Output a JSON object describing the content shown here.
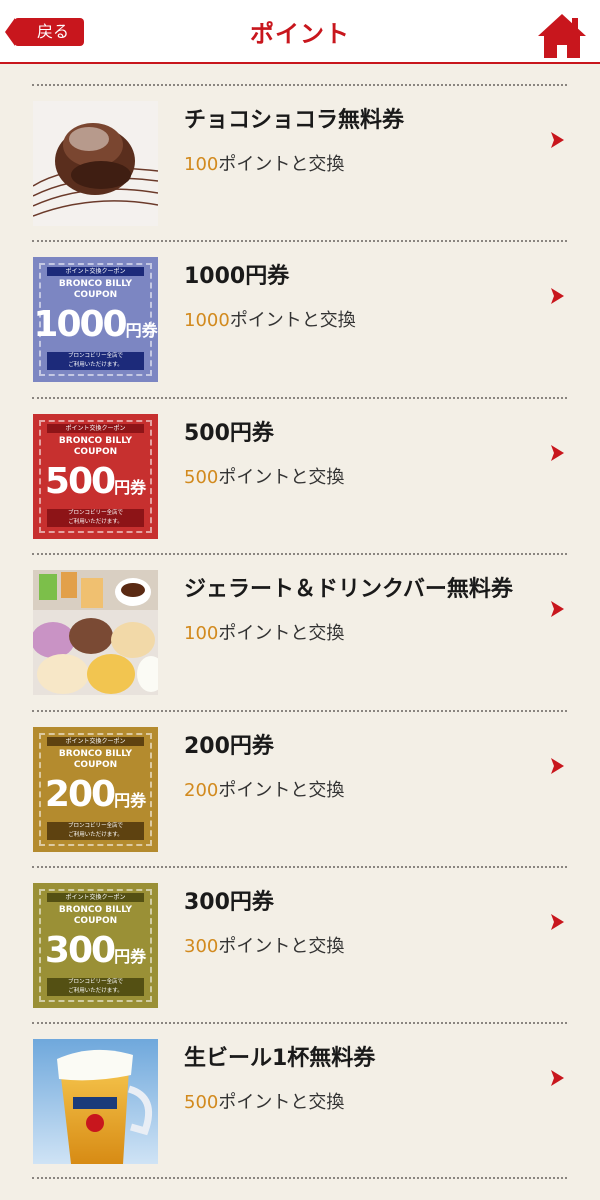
{
  "header": {
    "back_label": "戻る",
    "title": "ポイント"
  },
  "colors": {
    "accent": "#c8161d",
    "points": "#d28a1e",
    "background": "#f3efe6"
  },
  "items": [
    {
      "title": "チョコショコラ無料券",
      "points": "100",
      "suffix": "ポイントと交換",
      "thumb": "chocolate-dessert-photo"
    },
    {
      "title": "1000円券",
      "points": "1000",
      "suffix": "ポイントと交換",
      "thumb": "coupon",
      "coupon": {
        "top": "ポイント交換クーポン",
        "brand1": "BRONCO BILLY",
        "brand2": "COUPON",
        "amount": "1000",
        "yen": "円券",
        "bottom1": "ブロンコビリー全店で",
        "bottom2": "ご利用いただけます。",
        "color": "#7c86c2",
        "bar": "#1c2a7a"
      }
    },
    {
      "title": "500円券",
      "points": "500",
      "suffix": "ポイントと交換",
      "thumb": "coupon",
      "coupon": {
        "top": "ポイント交換クーポン",
        "brand1": "BRONCO BILLY",
        "brand2": "COUPON",
        "amount": "500",
        "yen": "円券",
        "bottom1": "ブロンコビリー全店で",
        "bottom2": "ご利用いただけます。",
        "color": "#c7302f",
        "bar": "#8d1417"
      }
    },
    {
      "title": "ジェラート＆ドリンクバー無料券",
      "points": "100",
      "suffix": "ポイントと交換",
      "thumb": "gelato-drink-photo"
    },
    {
      "title": "200円券",
      "points": "200",
      "suffix": "ポイントと交換",
      "thumb": "coupon",
      "coupon": {
        "top": "ポイント交換クーポン",
        "brand1": "BRONCO BILLY",
        "brand2": "COUPON",
        "amount": "200",
        "yen": "円券",
        "bottom1": "ブロンコビリー全店で",
        "bottom2": "ご利用いただけます。",
        "color": "#b48b2e",
        "bar": "#5e4210"
      }
    },
    {
      "title": "300円券",
      "points": "300",
      "suffix": "ポイントと交換",
      "thumb": "coupon",
      "coupon": {
        "top": "ポイント交換クーポン",
        "brand1": "BRONCO BILLY",
        "brand2": "COUPON",
        "amount": "300",
        "yen": "円券",
        "bottom1": "ブロンコビリー全店で",
        "bottom2": "ご利用いただけます。",
        "color": "#9a9036",
        "bar": "#545013"
      }
    },
    {
      "title": "生ビール1杯無料券",
      "points": "500",
      "suffix": "ポイントと交換",
      "thumb": "beer-photo"
    }
  ],
  "icons": {
    "back": "back-arrow",
    "home": "home-icon",
    "chevron": "chevron-right-icon"
  }
}
